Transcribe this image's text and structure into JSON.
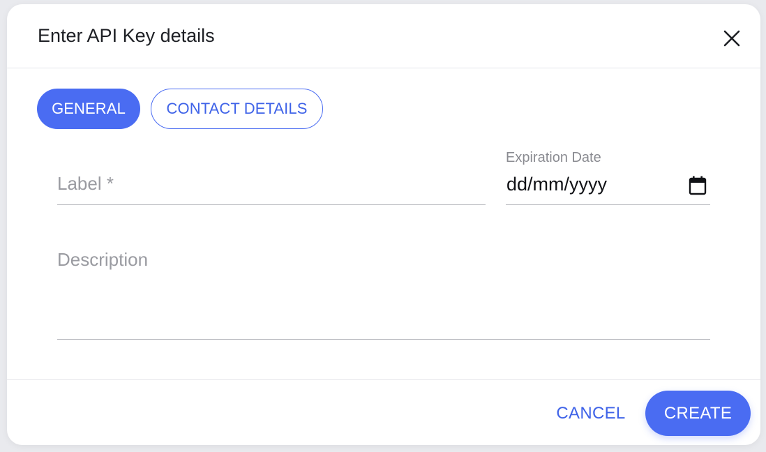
{
  "dialog": {
    "title": "Enter API Key details",
    "close_icon": "close-icon"
  },
  "tabs": [
    {
      "label": "GENERAL",
      "active": true
    },
    {
      "label": "CONTACT DETAILS",
      "active": false
    }
  ],
  "form": {
    "label_field": {
      "placeholder": "Label *",
      "value": ""
    },
    "expiration_date": {
      "label": "Expiration Date",
      "value": "dd/mm/yyyy",
      "icon": "calendar-icon"
    },
    "description": {
      "placeholder": "Description",
      "value": ""
    }
  },
  "footer": {
    "cancel_label": "CANCEL",
    "create_label": "CREATE"
  },
  "colors": {
    "accent": "#4a6cf2",
    "accent_text": "#3f63e8",
    "title_text": "#1d1f24",
    "placeholder_text": "#9a9ba1"
  }
}
